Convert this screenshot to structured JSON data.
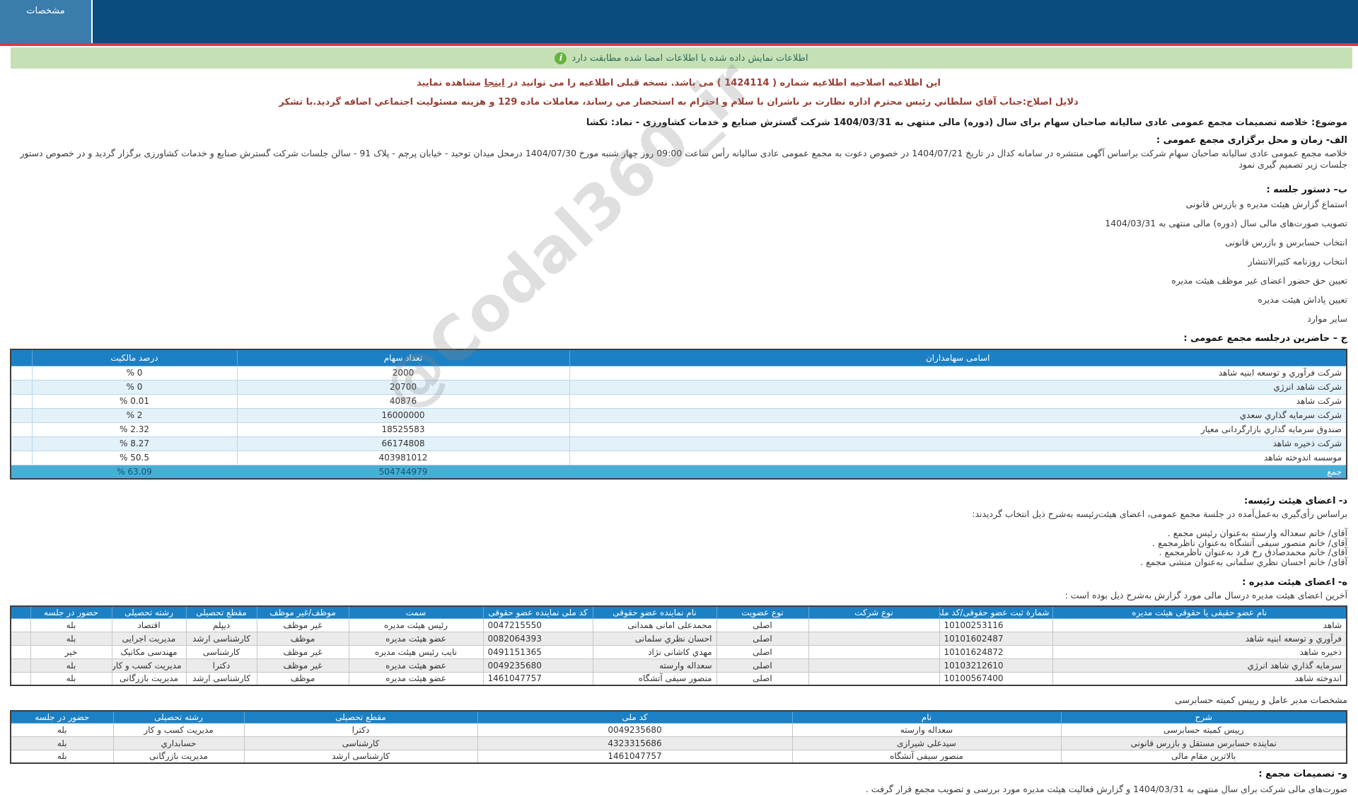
{
  "header": {
    "tab": "مشخصات"
  },
  "alert": {
    "message": "اطلاعات نمایش داده شده با اطلاعات امضا شده مطابقت دارد",
    "icon_glyph": "i"
  },
  "correction": {
    "notice_prefix": "این اطلاعیه اصلاحیه اطلاعیه شماره ( 1424114 ) می باشد. نسخه قبلی اطلاعیه را می توانید در ",
    "notice_link": "اینجا",
    "notice_suffix": " مشاهده نمایید",
    "reason": "دلایل اصلاح:جناب آقاي سلطاني رئیس محترم اداره نظارت بر ناشران با سلام و احترام به استحضار مي رساند، معاملات ماده 129 و هزینه مسئولیت اجتماعي اضافه گردید.با تشکر"
  },
  "subject": "موضوع: خلاصه تصمیمات مجمع عمومی عادی سالیانه صاحبان سهام برای سال (دوره) مالی منتهی به 1404/03/31 شرکت گسترش صنایع و خدمات کشاورزی - نماد: تکشا",
  "section_a": {
    "title": "الف- زمان و محل برگزاری مجمع عمومی :",
    "body": "خلاصه مجمع عمومی عادی سالیانه صاحبان سهام شرکت براساس آگهی منتشره در سامانه کدال در تاریخ 1404/07/21 در خصوص دعوت به مجمع عمومی عادی سالیانه رأس ساعت 09:00 روز چهار شنبه مورخ 1404/07/30 درمحل میدان توحید - خیابان پرچم - پلاک 91 - سالن جلسات شرکت گسترش صنایع و خدمات کشاورزی برگزار گردید و در خصوص دستور جلسات زیر تصمیم گیری نمود"
  },
  "section_b": {
    "title": "ب– دستور جلسه :",
    "items": [
      "استماع گزارش هیئت مدیره و بازرس قانونی",
      "تصویب صورت‌های مالی سال (دوره) مالی منتهی به 1404/03/31",
      "انتخاب حسابرس و بازرس قانونی",
      "انتخاب روزنامه کثیرالانتشار",
      "تعیین حق حضور اعضای غیر موظف هیئت مدیره",
      "تعیین پاداش هیئت مدیره",
      "سایر موارد"
    ]
  },
  "section_c": {
    "title": "ج – حاضرین درجلسه مجمع عمومی :",
    "table": {
      "headers": [
        "اسامی سهامداران",
        "تعداد سهام",
        "درصد مالکیت",
        ""
      ],
      "rows": [
        [
          "شرکت فرآوري و توسعه ابنیه شاهد",
          "2000",
          "% 0",
          ""
        ],
        [
          "شرکت شاهد انرژي",
          "20700",
          "% 0",
          ""
        ],
        [
          "شرکت شاهد",
          "40876",
          "% 0.01",
          ""
        ],
        [
          "شرکت سرمایه گذاري سعدي",
          "16000000",
          "% 2",
          ""
        ],
        [
          "صندوق سرمایه گذاري بازارگردانی معیار",
          "18525583",
          "% 2.32",
          ""
        ],
        [
          "شرکت ذخیره شاهد",
          "66174808",
          "% 8.27",
          ""
        ],
        [
          "موسسه اندوخته شاهد",
          "403981012",
          "% 50.5",
          ""
        ]
      ],
      "total": [
        "جمع",
        "504744979",
        "% 63.09",
        ""
      ]
    }
  },
  "section_d": {
    "title": "د- اعضای هیئت رئیسه:",
    "intro": "براساس رأی‌گیری به‌عمل‌آمده در جلسة مجمع عمومی، اعضای هیئت‌رئیسه به‌شرح ذیل انتخاب گردیدند:",
    "members": [
      "آقای/ خانم سعداله وارسته به‌عنوان رئیس مجمع .",
      "آقای/ خانم منصور سیفی آتشگاه به‌عنوان ناظرمجمع .",
      "آقای/ خانم محمدصادق رخ فرد به‌عنوان ناظرمجمع .",
      "آقای/ خانم احسان نظري سلمانی به‌عنوان منشی مجمع ."
    ]
  },
  "section_e": {
    "title": "ه- اعضای هیئت مدیره :",
    "intro": "آخرین اعضای هیئت مدیره درسال مالی مورد گزارش به‌شرح ذیل بوده است :",
    "table": {
      "headers": [
        "نام عضو حقیقی یا حقوقی هیئت مدیره",
        "شمارة ثبت عضو حقوقی/کد ملی",
        "نوع شرکت",
        "نوع عضویت",
        "نام نماینده عضو حقوقی",
        "کد ملی نماینده عضو حقوقی",
        "سمت",
        "موظف/غیر موظف",
        "مقطع تحصیلی",
        "رشته تحصیلی",
        "حضور در جلسه",
        ""
      ],
      "rows": [
        [
          "شاهد",
          "10100253116",
          "",
          "اصلی",
          "محمدعلی امانی همدانی",
          "0047215550",
          "رئیس هیئت مدیره",
          "غیر موظف",
          "دیپلم",
          "اقتصاد",
          "بله",
          ""
        ],
        [
          "فرآوري و توسعه ابنیه شاهد",
          "10101602487",
          "",
          "اصلی",
          "احسان نظري سلمانی",
          "0082064393",
          "عضو هیئت مدیره",
          "موظف",
          "کارشناسی ارشد",
          "مدیریت اجرایی",
          "بله",
          ""
        ],
        [
          "ذخیره شاهد",
          "10101624872",
          "",
          "اصلی",
          "مهدي کاشانی نژاد",
          "0491151365",
          "نایب رئیس هیئت مدیره",
          "غیر موظف",
          "کارشناسی",
          "مهندسی مکانیک",
          "خیر",
          ""
        ],
        [
          "سرمایه گذاري شاهد انرژي",
          "10103212610",
          "",
          "اصلی",
          "سعداله وارسته",
          "0049235680",
          "عضو هیئت مدیره",
          "غیر موظف",
          "دکترا",
          "مدیریت کسب و کار",
          "بله",
          ""
        ],
        [
          "اندوخته شاهد",
          "10100567400",
          "",
          "اصلی",
          "منصور سیفی آتشگاه",
          "1461047757",
          "عضو هیئت مدیره",
          "موظف",
          "کارشناسی ارشد",
          "مدیریت بازرگانی",
          "بله",
          ""
        ]
      ]
    }
  },
  "ceo_table": {
    "title": "مشخصات مدیر عامل و رییس کمیته حسابرسی",
    "headers": [
      "شرح",
      "نام",
      "کد ملی",
      "مقطع تحصیلی",
      "رشته تحصیلی",
      "حضور در جلسه"
    ],
    "rows": [
      [
        "رییس کمیته حسابرسی",
        "سعداله وارسته",
        "0049235680",
        "دکترا",
        "مدیریت کسب و کار",
        "بله"
      ],
      [
        "نماینده حسابرس مستقل و بازرس قانونی",
        "سیدعلی شیرازی",
        "4323315686",
        "کارشناسی",
        "حسابداري",
        "بله"
      ],
      [
        "بالاترین مقام مالی",
        "منصور سیفی آتشگاه",
        "1461047757",
        "کارشناسی ارشد",
        "مدیریت بازرگانی",
        "بله"
      ]
    ]
  },
  "section_f": {
    "title": "و- تصمیمات مجمع :",
    "body": "صورت‌های مالی شرکت برای سال منتهی به 1404/03/31 و گزارش فعالیت هیئت مدیره مورد بررسی و تصویب مجمع قرار گرفت ."
  },
  "watermark": "@Codal360_ir",
  "colors": {
    "header_navy": "#0a4c7d",
    "tab_blue": "#3a7dad",
    "red_line": "#da3a33",
    "alert_green_bg": "#c6e0b6",
    "maroon": "#9a3e33",
    "table_header_blue": "#1c80c4",
    "total_row_blue": "#49aed6",
    "alt_row_blue": "#e3f1f9"
  }
}
